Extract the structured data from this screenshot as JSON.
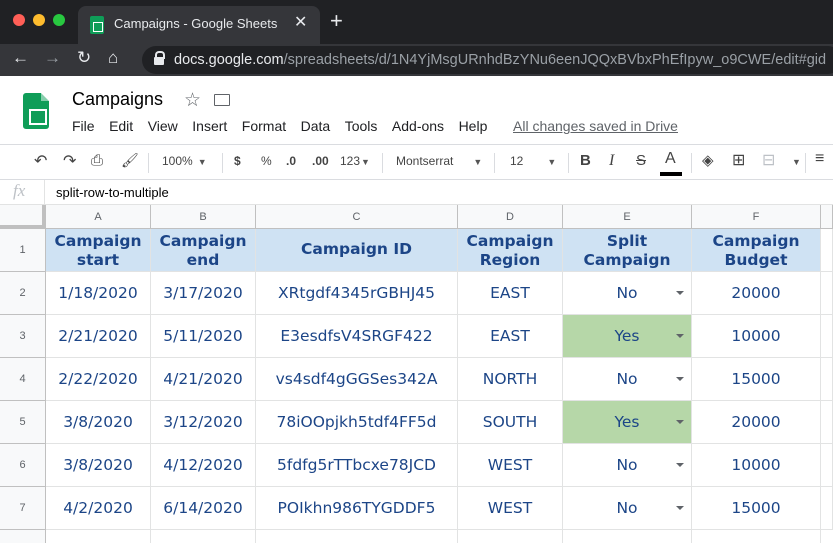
{
  "browser": {
    "tab_title": "Campaigns - Google Sheets",
    "new_tab": "+",
    "close": "✕",
    "url_host": "docs.google.com",
    "url_path": "/spreadsheets/d/1N4YjMsgURnhdBzYNu6eenJQQxBVbxPhEfIpyw_o9CWE/edit#gid"
  },
  "doc": {
    "title": "Campaigns",
    "menu": [
      "File",
      "Edit",
      "View",
      "Insert",
      "Format",
      "Data",
      "Tools",
      "Add-ons",
      "Help"
    ],
    "saved_status": "All changes saved in Drive"
  },
  "toolbar": {
    "zoom": "100%",
    "currency": "$",
    "percent": "%",
    "decrease_decimal": ".0",
    "increase_decimal": ".00",
    "number_format": "123",
    "font": "Montserrat",
    "font_size": "12",
    "bold": "B",
    "italic": "I",
    "strike": "S",
    "text_color": "A"
  },
  "formula_bar": {
    "fx": "fx",
    "value": "split-row-to-multiple"
  },
  "sheet": {
    "columns": [
      "A",
      "B",
      "C",
      "D",
      "E",
      "F"
    ],
    "row_numbers": [
      "1",
      "2",
      "3",
      "4",
      "5",
      "6",
      "7"
    ],
    "headers": [
      [
        "Campaign",
        "start"
      ],
      [
        "Campaign",
        "end"
      ],
      [
        "Campaign ID",
        ""
      ],
      [
        "Campaign",
        "Region"
      ],
      [
        "Split",
        "Campaign"
      ],
      [
        "Campaign",
        "Budget"
      ]
    ],
    "rows": [
      [
        "1/18/2020",
        "3/17/2020",
        "XRtgdf4345rGBHJ45",
        "EAST",
        "No",
        "20000"
      ],
      [
        "2/21/2020",
        "5/11/2020",
        "E3esdfsV4SRGF422",
        "EAST",
        "Yes",
        "10000"
      ],
      [
        "2/22/2020",
        "4/21/2020",
        "vs4sdf4gGGSes342A",
        "NORTH",
        "No",
        "15000"
      ],
      [
        "3/8/2020",
        "3/12/2020",
        "78iOOpjkh5tdf4FF5d",
        "SOUTH",
        "Yes",
        "20000"
      ],
      [
        "3/8/2020",
        "4/12/2020",
        "5fdfg5rTTbcxe78JCD",
        "WEST",
        "No",
        "10000"
      ],
      [
        "4/2/2020",
        "6/14/2020",
        "POIkhn986TYGDDF5",
        "WEST",
        "No",
        "15000"
      ]
    ]
  },
  "colors": {
    "header_fill": "#cfe2f3",
    "yes_fill": "#b6d7a8",
    "cell_text": "#1c4587"
  }
}
